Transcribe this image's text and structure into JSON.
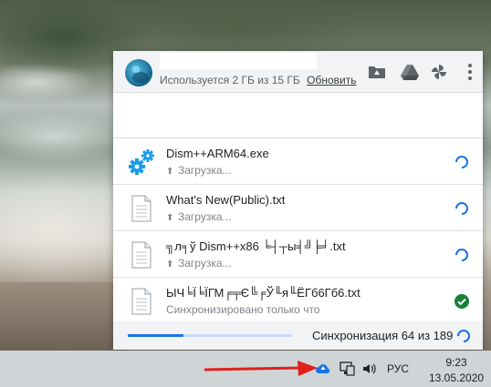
{
  "panel": {
    "header": {
      "usage_text": "Используется 2 ГБ из 15 ГБ",
      "upgrade_link": "Обновить"
    },
    "files": [
      {
        "name": "Dism++ARM64.exe",
        "status": "Загрузка...",
        "icon": "gears-icon",
        "state": "syncing"
      },
      {
        "name": "What's New(Public).txt",
        "status": "Загрузка...",
        "icon": "document-icon",
        "state": "syncing"
      },
      {
        "name": "╗л╕ў Dism++x86 ╘┤┬ы╡╝╞╛.txt",
        "status": "Загрузка...",
        "icon": "document-icon",
        "state": "syncing"
      },
      {
        "name": "ЫЧ╘Ї╘ЇГМ╒╤Є╚╒Ў╙я╙ЁГб6Гб6.txt",
        "status": "Синхронизировано только что",
        "icon": "document-icon",
        "state": "done"
      }
    ],
    "footer": {
      "sync_text": "Синхронизация 64 из 189",
      "progress": 0.34
    }
  },
  "taskbar": {
    "language": "РУС",
    "time": "9:23",
    "date": "13.05.2020"
  },
  "colors": {
    "accent": "#1a73e8",
    "done": "#188038",
    "gear": "#1a9be6"
  }
}
